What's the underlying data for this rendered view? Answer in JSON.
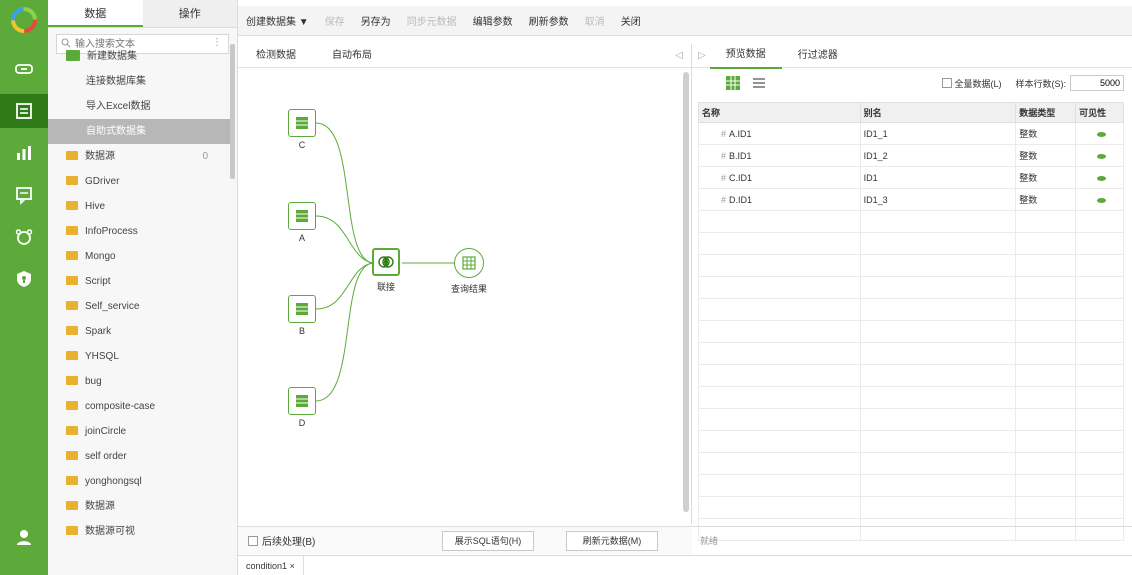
{
  "rail": {
    "items": [
      {
        "name": "link-icon",
        "active": false
      },
      {
        "name": "dataset-icon",
        "active": true
      },
      {
        "name": "chart-icon",
        "active": false
      },
      {
        "name": "message-icon",
        "active": false
      },
      {
        "name": "bear-icon",
        "active": false
      },
      {
        "name": "shield-icon",
        "active": false
      }
    ],
    "user_icon": "user-icon"
  },
  "tree": {
    "tabs": [
      "数据",
      "操作"
    ],
    "search_placeholder": "输入搜索文本",
    "root_label": "新建数据集",
    "children": [
      "连接数据库集",
      "导入Excel数据",
      "自助式数据集"
    ],
    "folders": [
      {
        "label": "数据源",
        "count": "0"
      },
      {
        "label": "GDriver"
      },
      {
        "label": "Hive"
      },
      {
        "label": "InfoProcess"
      },
      {
        "label": "Mongo"
      },
      {
        "label": "Script"
      },
      {
        "label": "Self_service"
      },
      {
        "label": "Spark"
      },
      {
        "label": "YHSQL"
      },
      {
        "label": "bug"
      },
      {
        "label": "composite-case"
      },
      {
        "label": "joinCircle"
      },
      {
        "label": "self order"
      },
      {
        "label": "yonghongsql"
      },
      {
        "label": "数据源"
      },
      {
        "label": "数据源可视"
      }
    ]
  },
  "toolbar": {
    "new_dataset": "创建数据集 ▼",
    "save": "保存",
    "save_as": "另存为",
    "sync": "同步元数据",
    "edit_params": "编辑参数",
    "refresh_params": "刷新参数",
    "cancel": "取消",
    "close": "关闭"
  },
  "design": {
    "tabs": [
      "检测数据",
      "自动布局"
    ],
    "nodes": [
      "C",
      "A",
      "B",
      "D"
    ],
    "join_label": "联接",
    "output_label": "查询结果",
    "bottom_check": "后续处理(B)",
    "btn_sql": "展示SQL语句(H)",
    "btn_meta": "刷新元数据(M)"
  },
  "preview": {
    "tabs": [
      "预览数据",
      "行过滤器"
    ],
    "all_data_label": "全量数据(L)",
    "sample_rows_label": "样本行数(S):",
    "sample_rows_value": "5000",
    "columns": [
      "名称",
      "别名",
      "数据类型",
      "可见性"
    ],
    "rows": [
      {
        "field": "A.ID1",
        "alias": "ID1_1",
        "type": "整数"
      },
      {
        "field": "B.ID1",
        "alias": "ID1_2",
        "type": "整数"
      },
      {
        "field": "C.ID1",
        "alias": "ID1",
        "type": "整数"
      },
      {
        "field": "D.ID1",
        "alias": "ID1_3",
        "type": "整数"
      }
    ],
    "bottom_text": "就绪"
  },
  "condition": {
    "tab_label": "condition1",
    "tab_close": "×"
  }
}
